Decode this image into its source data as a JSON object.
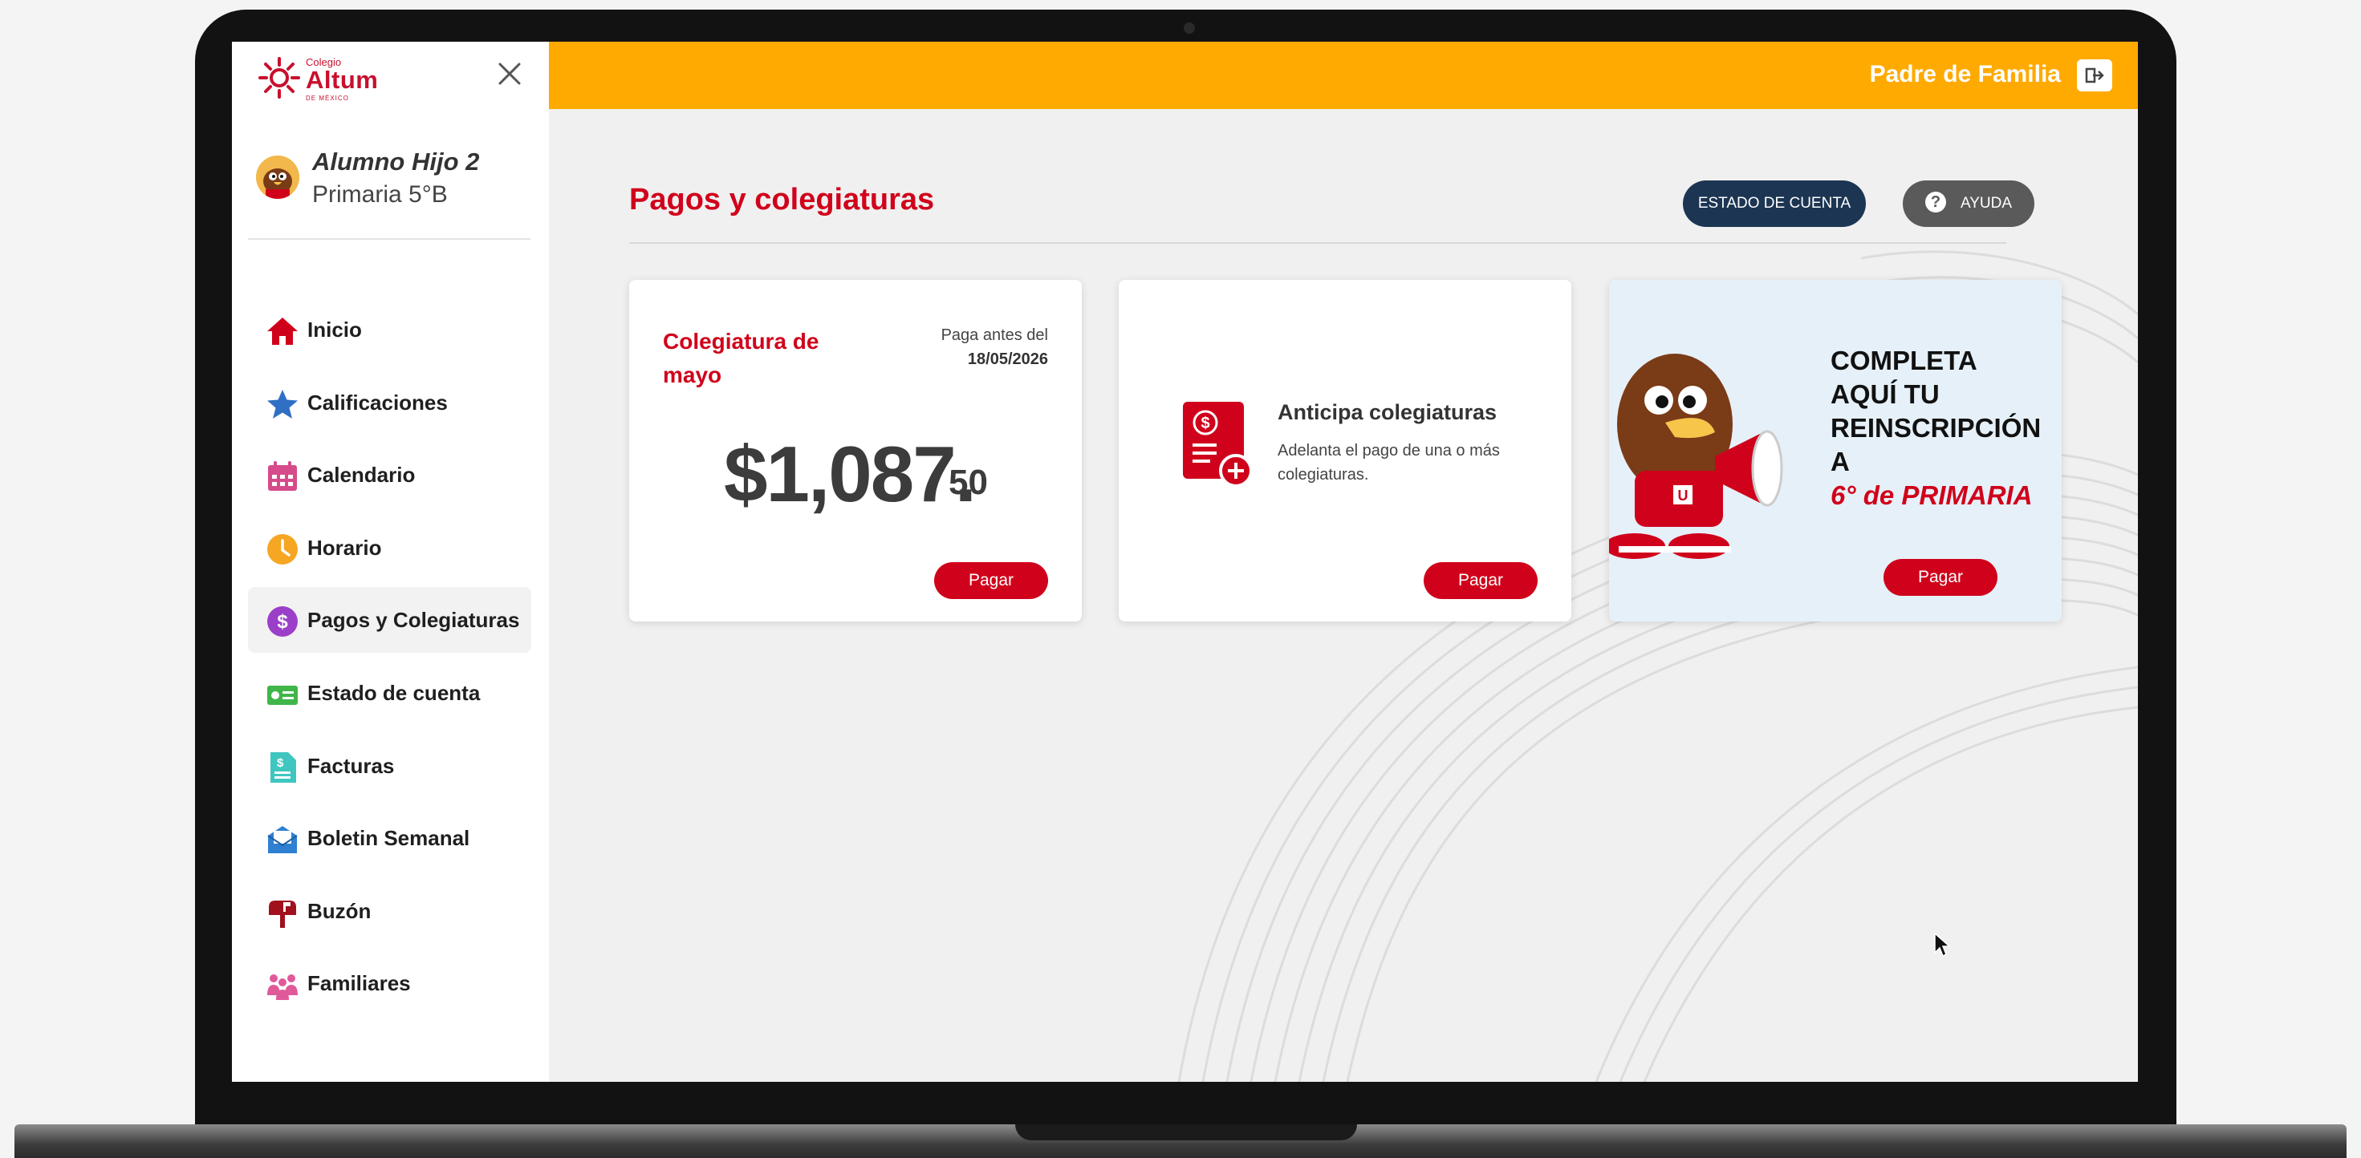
{
  "sidebar": {
    "logo": {
      "small": "Colegio",
      "name": "Altum",
      "tiny": "DE MÉXICO"
    },
    "student": {
      "name": "Alumno Hijo 2",
      "grade": "Primaria 5°B"
    },
    "items": [
      {
        "label": "Inicio",
        "icon": "home-icon",
        "color": "#d0021b"
      },
      {
        "label": "Calificaciones",
        "icon": "star-icon",
        "color": "#2f6fc4"
      },
      {
        "label": "Calendario",
        "icon": "calendar-icon",
        "color": "#d64b8c"
      },
      {
        "label": "Horario",
        "icon": "clock-icon",
        "color": "#f5a623"
      },
      {
        "label": "Pagos y Colegiaturas",
        "icon": "dollar-icon",
        "color": "#9b3fc8",
        "active": true
      },
      {
        "label": "Estado de cuenta",
        "icon": "account-card-icon",
        "color": "#3fb54a"
      },
      {
        "label": "Facturas",
        "icon": "invoice-icon",
        "color": "#3fc6c0"
      },
      {
        "label": "Boletin Semanal",
        "icon": "newsletter-icon",
        "color": "#2f80d1"
      },
      {
        "label": "Buzón",
        "icon": "mailbox-icon",
        "color": "#a0101d"
      },
      {
        "label": "Familiares",
        "icon": "family-icon",
        "color": "#e05a9a"
      }
    ]
  },
  "header": {
    "user_role": "Padre de Familia"
  },
  "page": {
    "title": "Pagos y colegiaturas",
    "estado_button": "ESTADO DE CUENTA",
    "ayuda_button": "AYUDA",
    "help_glyph": "?"
  },
  "cards": {
    "colegiatura": {
      "title": "Colegiatura de mayo",
      "due_label": "Paga antes del",
      "due_date": "18/05/2026",
      "amount_main": "$1,087.",
      "amount_cents": "50",
      "button": "Pagar"
    },
    "anticipa": {
      "title": "Anticipa colegiaturas",
      "description": "Adelanta el pago de una o más colegiaturas.",
      "button": "Pagar"
    },
    "reinscripcion": {
      "text": "COMPLETA AQUÍ TU REINSCRIPCIÓN A",
      "highlight": "6° de PRIMARIA",
      "button": "Pagar"
    }
  },
  "colors": {
    "accent_orange": "#ffaa00",
    "brand_red": "#d0021b",
    "navy": "#1c3553"
  }
}
